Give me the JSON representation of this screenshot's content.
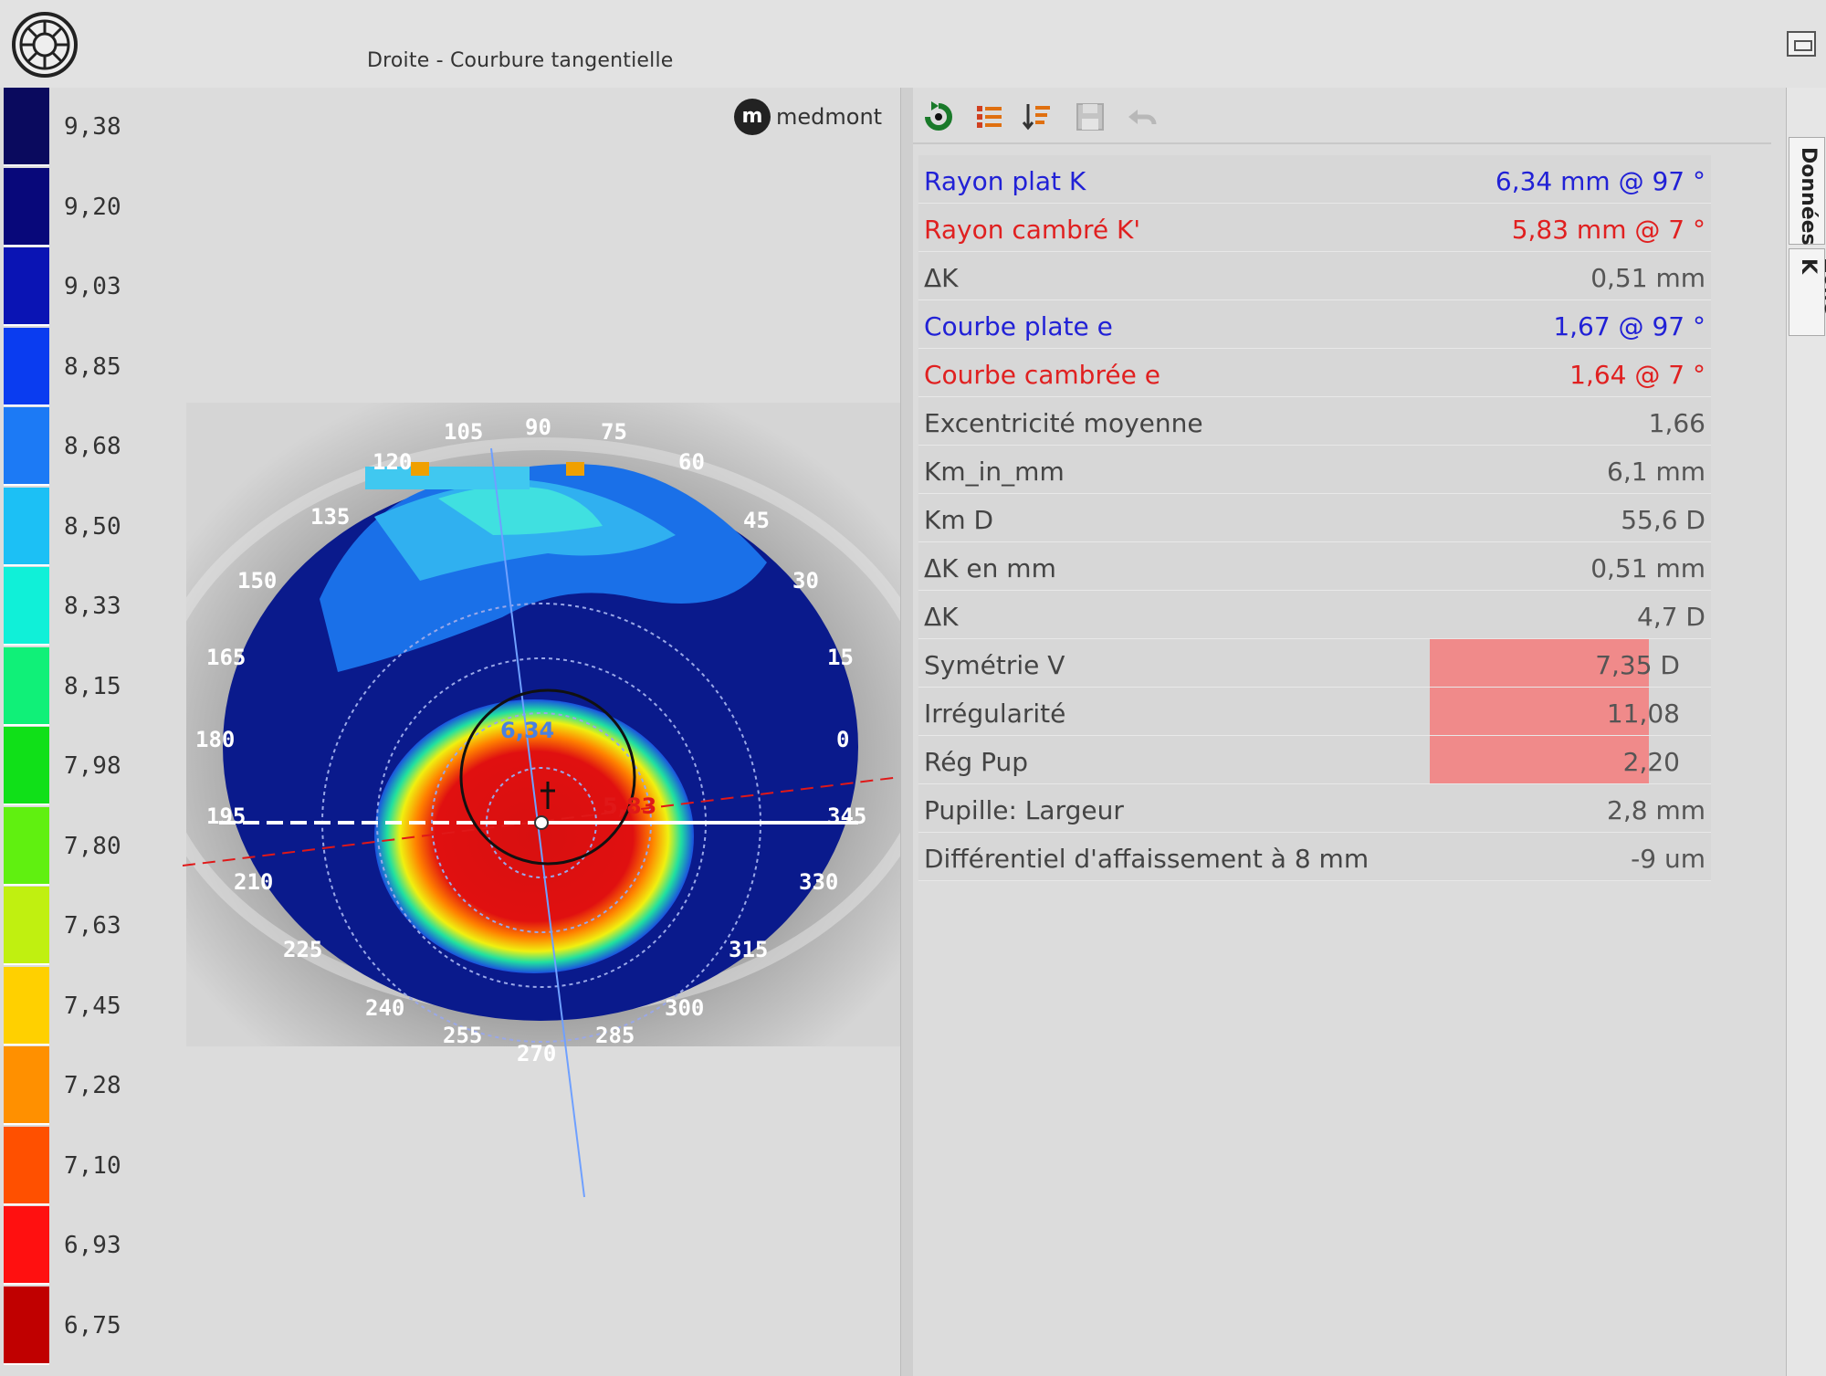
{
  "window": {
    "title": "Droite - Courbure tangentielle",
    "brand": "medmont"
  },
  "scale": {
    "unit": "mm",
    "items": [
      {
        "label": "9,38",
        "color": "#0a0a5e"
      },
      {
        "label": "9,20",
        "color": "#08087a"
      },
      {
        "label": "9,03",
        "color": "#0a14b4"
      },
      {
        "label": "8,85",
        "color": "#0a3cf0"
      },
      {
        "label": "8,68",
        "color": "#1c7af5"
      },
      {
        "label": "8,50",
        "color": "#1cc0f5"
      },
      {
        "label": "8,33",
        "color": "#10f0d8"
      },
      {
        "label": "8,15",
        "color": "#10f078"
      },
      {
        "label": "7,98",
        "color": "#10e018"
      },
      {
        "label": "7,80",
        "color": "#60f010"
      },
      {
        "label": "7,63",
        "color": "#c0f010"
      },
      {
        "label": "7,45",
        "color": "#ffd000"
      },
      {
        "label": "7,28",
        "color": "#ff9000"
      },
      {
        "label": "7,10",
        "color": "#ff5000"
      },
      {
        "label": "6,93",
        "color": "#ff1010"
      },
      {
        "label": "6,75",
        "color": "#c00000"
      }
    ]
  },
  "map": {
    "angle_labels": [
      "105",
      "90",
      "75",
      "120",
      "60",
      "135",
      "45",
      "150",
      "30",
      "165",
      "15",
      "180",
      "0",
      "195",
      "345",
      "210",
      "330",
      "225",
      "315",
      "240",
      "300",
      "255",
      "270",
      "285"
    ],
    "flat_value": "6,34",
    "steep_value": "5,83"
  },
  "toolbar": {
    "icons": [
      "refresh-icon",
      "list-icon",
      "sort-icon",
      "save-icon",
      "undo-icon"
    ]
  },
  "data_rows": [
    {
      "label": "Rayon plat K",
      "value": "6,34 mm @  97 °",
      "style": "blue"
    },
    {
      "label": "Rayon cambré K'",
      "value": "5,83 mm @   7 °",
      "style": "red"
    },
    {
      "label": "ΔK",
      "value": "0,51 mm",
      "style": ""
    },
    {
      "label": "Courbe plate e",
      "value": "1,67 @  97 °",
      "style": "blue"
    },
    {
      "label": "Courbe cambrée e",
      "value": "1,64 @   7 °",
      "style": "red"
    },
    {
      "label": "Excentricité moyenne",
      "value": "1,66",
      "style": ""
    },
    {
      "label": "Km_in_mm",
      "value": "6,1 mm",
      "style": ""
    },
    {
      "label": "Km D",
      "value": "55,6 D",
      "style": ""
    },
    {
      "label": "ΔK en mm",
      "value": "0,51 mm",
      "style": ""
    },
    {
      "label": "ΔK",
      "value": "4,7 D",
      "style": ""
    },
    {
      "label": "Symétrie V",
      "value": "7,35 D",
      "style": "hi"
    },
    {
      "label": "Irrégularité",
      "value": "11,08",
      "style": "hi"
    },
    {
      "label": "Rég Pup",
      "value": "2,20",
      "style": "hi"
    },
    {
      "label": "Pupille: Largeur",
      "value": "2,8 mm",
      "style": ""
    },
    {
      "label": "Différentiel d'affaissement à 8 mm",
      "value": "-9 um",
      "style": ""
    }
  ],
  "side_tabs": [
    "Données",
    "Zone K"
  ]
}
